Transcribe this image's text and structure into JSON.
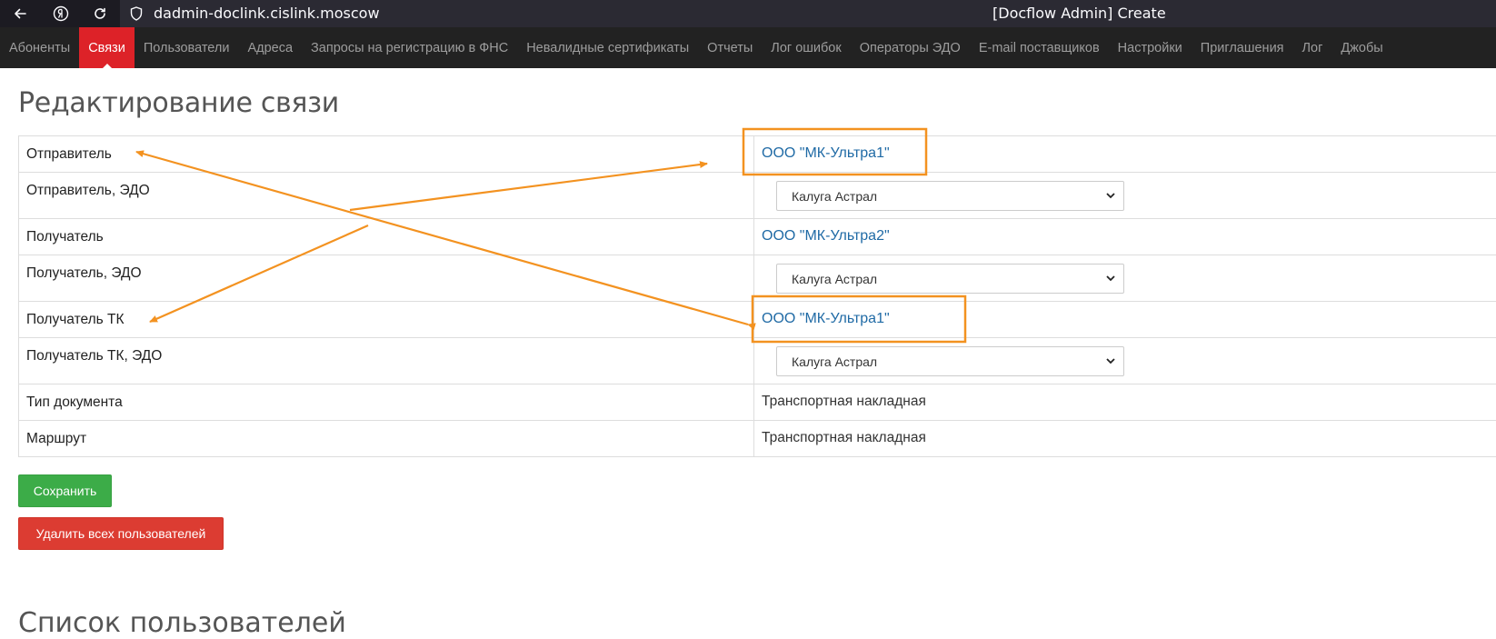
{
  "browser": {
    "url": "dadmin-doclink.cislink.moscow",
    "window_title": "[Docflow Admin] Create"
  },
  "nav": {
    "items": [
      {
        "label": "Абоненты"
      },
      {
        "label": "Связи",
        "active": true
      },
      {
        "label": "Пользователи"
      },
      {
        "label": "Адреса"
      },
      {
        "label": "Запросы на регистрацию в ФНС"
      },
      {
        "label": "Невалидные сертификаты"
      },
      {
        "label": "Отчеты"
      },
      {
        "label": "Лог ошибок"
      },
      {
        "label": "Операторы ЭДО"
      },
      {
        "label": "E-mail поставщиков"
      },
      {
        "label": "Настройки"
      },
      {
        "label": "Приглашения"
      },
      {
        "label": "Лог"
      },
      {
        "label": "Джобы"
      }
    ]
  },
  "page": {
    "title": "Редактирование связи",
    "subtitle": "Список пользователей"
  },
  "form": {
    "sender": {
      "label": "Отправитель",
      "value": "ООО \"МК-Ультра1\""
    },
    "sender_edo": {
      "label": "Отправитель, ЭДО",
      "value": "Калуга Астрал"
    },
    "recipient": {
      "label": "Получатель",
      "value": "ООО \"МК-Ультра2\""
    },
    "recipient_edo": {
      "label": "Получатель, ЭДО",
      "value": "Калуга Астрал"
    },
    "recipient_tk": {
      "label": "Получатель ТК",
      "value": "ООО \"МК-Ультра1\""
    },
    "recipient_tk_edo": {
      "label": "Получатель ТК, ЭДО",
      "value": "Калуга Астрал"
    },
    "doc_type": {
      "label": "Тип документа",
      "value": "Транспортная накладная"
    },
    "route": {
      "label": "Маршрут",
      "value": "Транспортная накладная"
    }
  },
  "buttons": {
    "save": "Сохранить",
    "delete_all_users": "Удалить всех пользователей"
  },
  "colors": {
    "navbar_bg": "#222222",
    "nav_active": "#dd2228",
    "link": "#1f6aa5",
    "save_button": "#3cac48",
    "delete_button": "#dc3c32",
    "annotation": "#f39220"
  }
}
